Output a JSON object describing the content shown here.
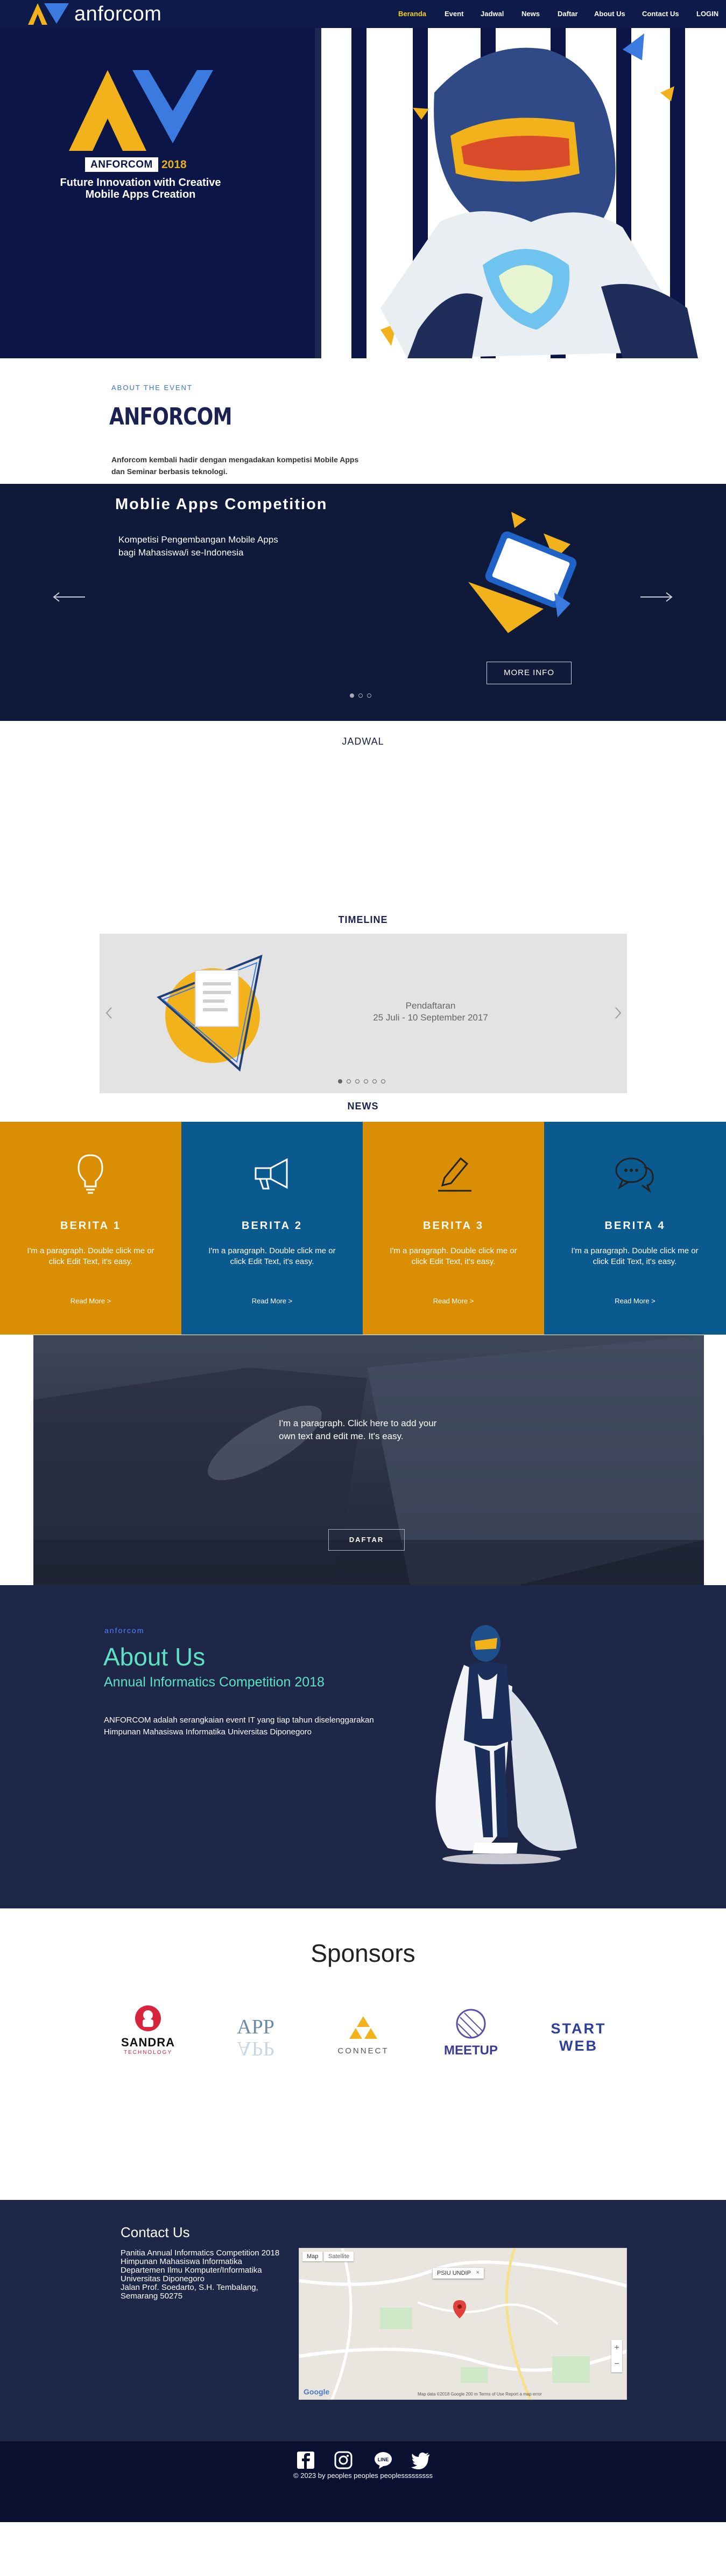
{
  "brand": {
    "name": "anforcom",
    "accent": "#f2b21b",
    "navy": "#0d1a4a"
  },
  "nav": {
    "items": [
      {
        "label": "Beranda",
        "active": true
      },
      {
        "label": "Event"
      },
      {
        "label": "Jadwal"
      },
      {
        "label": "News"
      },
      {
        "label": "Daftar"
      },
      {
        "label": "About Us"
      },
      {
        "label": "Contact Us"
      },
      {
        "label": "LOGIN"
      }
    ],
    "active_color": "#f2d21b"
  },
  "hero": {
    "badge": "ANFORCOM",
    "badge_year": "2018",
    "tagline": "Future Innovation with Creative Mobile Apps Creation"
  },
  "about_event": {
    "kicker": "ABOUT THE EVENT",
    "title": "ANFORCOM",
    "description": "Anforcom kembali hadir dengan mengadakan kompetisi Mobile Apps dan Seminar berbasis teknologi."
  },
  "slider": {
    "title": "Moblie Apps Competition",
    "description": "Kompetisi Pengembangan Mobile Apps bagi Mahasiswa/i se-Indonesia",
    "button": "MORE INFO",
    "dots": 3,
    "active_dot": 0
  },
  "jadwal": {
    "title": "JADWAL"
  },
  "timeline": {
    "title": "TIMELINE",
    "label": "Pendaftaran",
    "date": "25 Juli - 10 September 2017",
    "dots": 6,
    "active_dot": 0
  },
  "news": {
    "title": "NEWS",
    "cards": [
      {
        "title": "BERITA 1",
        "body": "I'm a paragraph. Double click me or click Edit Text, it's easy.",
        "more": "Read More >",
        "icon": "lightbulb-icon",
        "color": "#d98e04"
      },
      {
        "title": "BERITA 2",
        "body": "I'm a paragraph. Double click me or click Edit Text, it's easy.",
        "more": "Read More >",
        "icon": "megaphone-icon",
        "color": "#0b5a8f"
      },
      {
        "title": "BERITA 3",
        "body": "I'm a paragraph. Double click me or click Edit Text, it's easy.",
        "more": "Read More >",
        "icon": "pencil-icon",
        "color": "#d98e04"
      },
      {
        "title": "BERITA 4",
        "body": "I'm a paragraph. Double click me or click Edit Text, it's easy.",
        "more": "Read More >",
        "icon": "chat-icon",
        "color": "#0b5a8f"
      }
    ]
  },
  "promo": {
    "text": "I'm a paragraph. Click here to add your own text and edit me. It's easy.",
    "button": "DAFTAR"
  },
  "about_us": {
    "kicker": "anforcom",
    "title": "About Us",
    "subtitle": "Annual Informatics Competition 2018",
    "description": "ANFORCOM adalah serangkaian event IT yang tiap tahun diselenggarakan Himpunan Mahasiswa Informatika Universitas Diponegoro"
  },
  "sponsors": {
    "title": "Sponsors",
    "items": [
      {
        "name": "SANDRA",
        "sub": "TECHNOLOGY"
      },
      {
        "name": "APP"
      },
      {
        "name": "CONNECT"
      },
      {
        "name": "MEETUP"
      },
      {
        "name": "START",
        "name2": "WEB"
      }
    ]
  },
  "contact": {
    "title": "Contact Us",
    "lines": [
      "Panitia Annual Informatics Competition 2018",
      "Himpunan Mahasiswa Informatika",
      "Departemen Ilmu Komputer/Informatika",
      "Universitas Diponegoro",
      "Jalan Prof. Soedarto, S.H. Tembalang,",
      "Semarang 50275"
    ],
    "map": {
      "tab_map": "Map",
      "tab_satellite": "Satellite",
      "pin_label": "PSIU UNDIP",
      "google": "Google",
      "terms": "Map data ©2018 Google  200 m  Terms of Use  Report a map error"
    }
  },
  "footer": {
    "social": [
      "facebook-icon",
      "instagram-icon",
      "line-icon",
      "twitter-icon"
    ],
    "copyright": "© 2023 by peoples peoples peoplesssssssss"
  }
}
